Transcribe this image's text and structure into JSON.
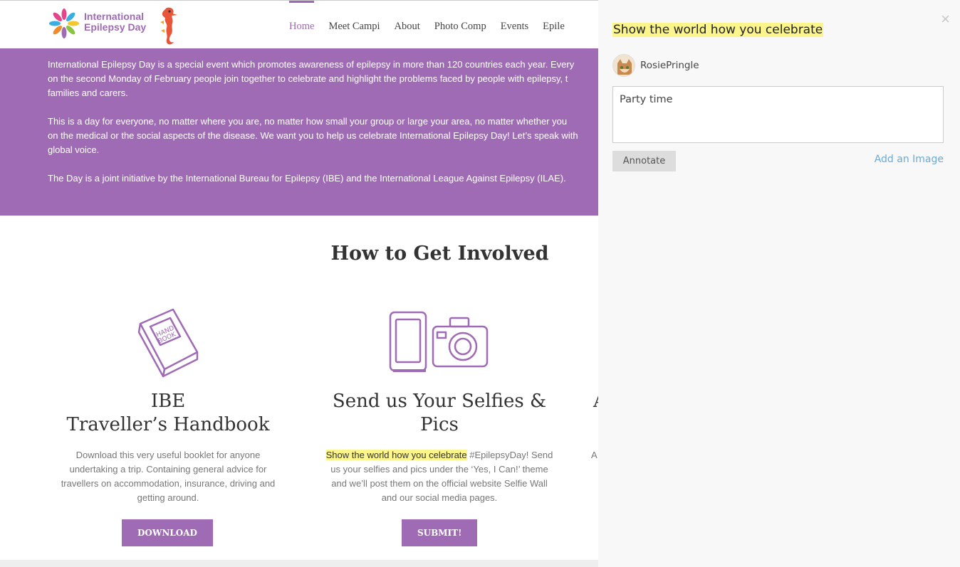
{
  "brand": {
    "logo_line1": "International",
    "logo_line2": "Epilepsy Day",
    "accent_color": "#a06bb5",
    "highlight_color": "#fbf58b"
  },
  "nav": {
    "items": [
      "Home",
      "Meet Campi",
      "About",
      "Photo Comp",
      "Events",
      "Epile"
    ],
    "active": "Home"
  },
  "intro": {
    "paragraphs": [
      [
        "International Epilepsy Day is a special event which promotes awareness of epilepsy in more than 120 countries each year. Every",
        "on the second Monday of February people join together to celebrate and highlight the problems faced by people with epilepsy, t",
        "families and carers."
      ],
      [
        "This is a day for everyone, no matter where you are, no matter how small your group or large your area, no matter whether you",
        "on the medical or the social aspects of the disease. We want you to help us celebrate International Epilepsy Day! Let’s speak with",
        "global voice."
      ],
      [
        "The Day is a joint initiative by the International Bureau for Epilepsy (IBE) and the International League Against Epilepsy (ILAE)."
      ]
    ]
  },
  "involved": {
    "title": "How to Get Involved",
    "handbook": {
      "icon": "handbook-icon",
      "heading_line1": "IBE",
      "heading_line2": "Traveller’s Handbook",
      "text": "Download this very useful booklet for anyone undertaking a trip. Containing general advice for travellers on accommodation, insurance, driving and getting around.",
      "button": "DOWNLOAD"
    },
    "selfies": {
      "icon": "phone-camera-icon",
      "heading_line1": "Send us Your Selfies &",
      "heading_line2": "Pics",
      "text_highlight": "Show the world how you celebrate",
      "text_rest": " #EpilepsyDay! Send us your selfies and pics under the ‘Yes, I Can!’ theme and we’ll post them on the official website Selfie Wall and our social media pages.",
      "button": "SUBMIT!"
    },
    "third": {
      "heading_fragment": "A",
      "text_fragment": "A"
    }
  },
  "annotation": {
    "quote": "Show the world how you celebrate",
    "username": "RosiePringle",
    "comment_value": "Party time",
    "annotate_button": "Annotate",
    "add_image_link": "Add an Image",
    "close_glyph": "×"
  }
}
